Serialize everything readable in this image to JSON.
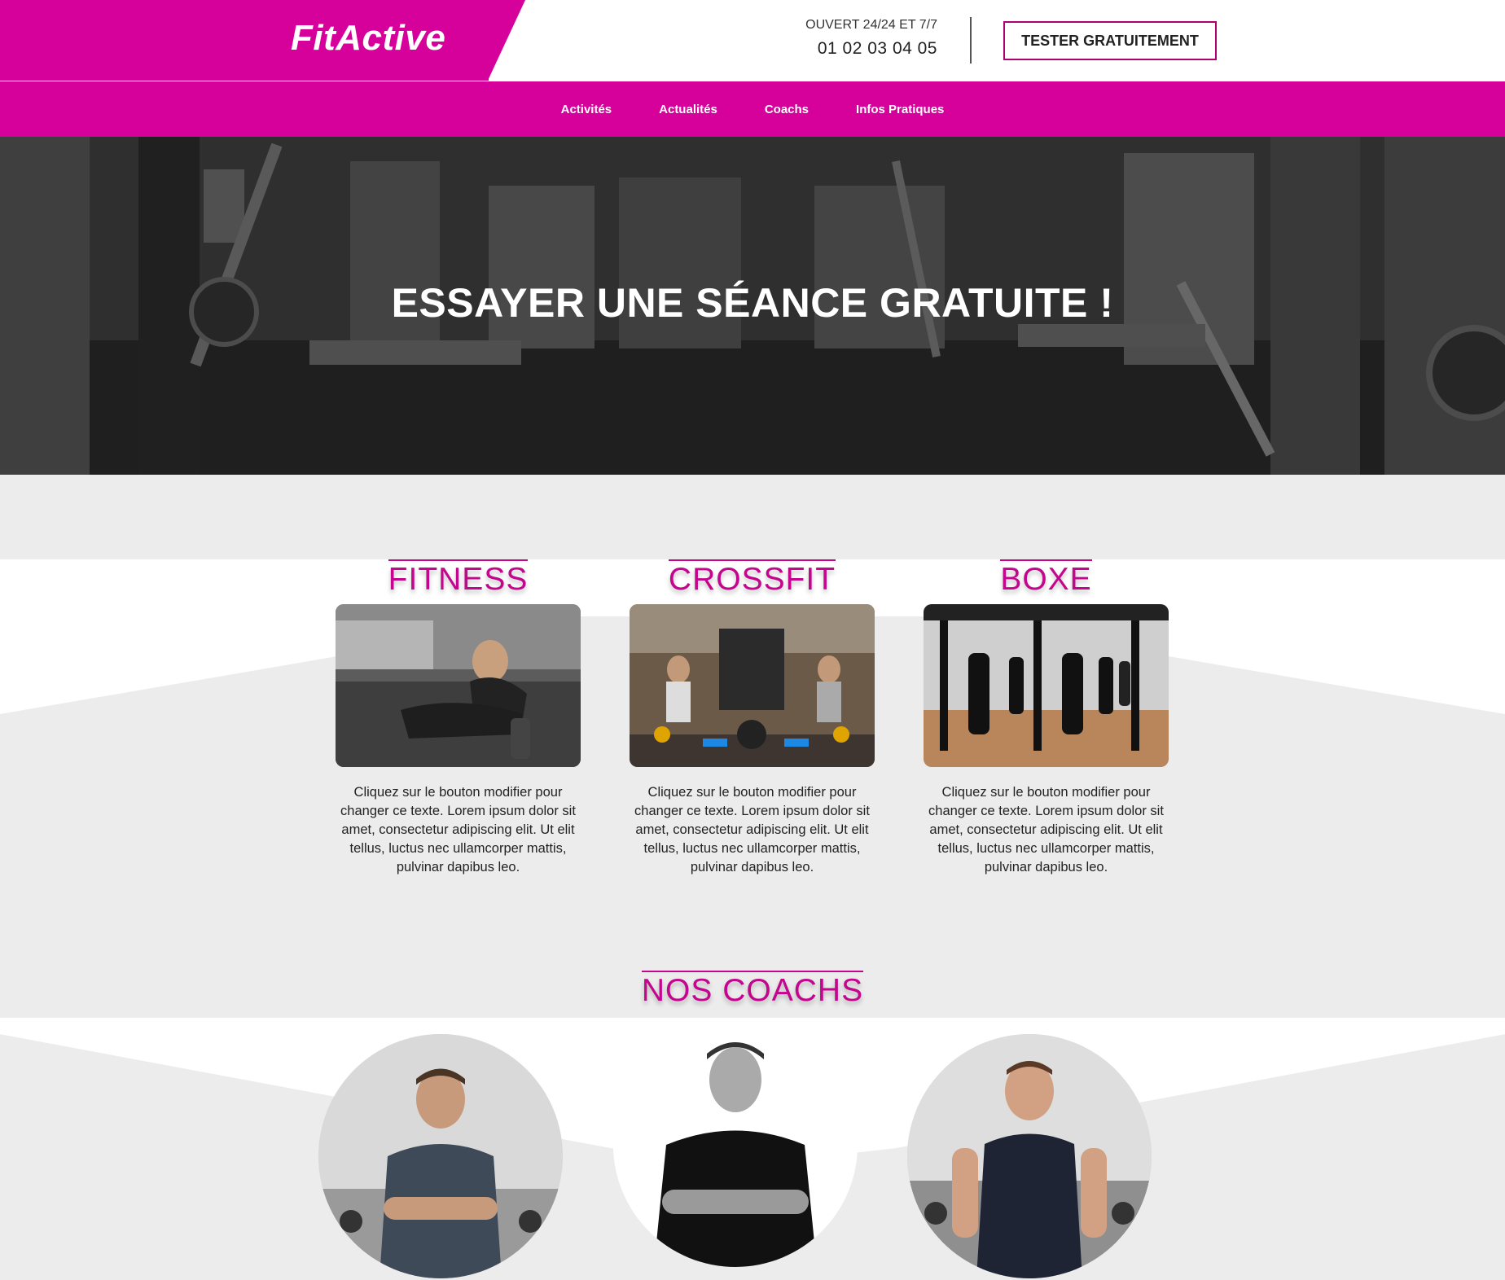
{
  "brand": {
    "logo": "FitActive",
    "accent": "#d6009b"
  },
  "header": {
    "hours": "OUVERT 24/24 ET 7/7",
    "phone": "01 02 03 04 05",
    "cta_label": "TESTER GRATUITEMENT"
  },
  "nav": {
    "items": [
      {
        "label": "Activités"
      },
      {
        "label": "Actualités"
      },
      {
        "label": "Coachs"
      },
      {
        "label": "Infos Pratiques"
      }
    ]
  },
  "hero": {
    "title": "ESSAYER UNE SÉANCE GRATUITE !"
  },
  "activities": [
    {
      "title": "FITNESS",
      "text": "Cliquez sur le bouton modifier pour changer ce texte. Lorem ipsum dolor sit amet, consectetur adipiscing elit. Ut elit tellus, luctus nec ullamcorper mattis, pulvinar dapibus leo."
    },
    {
      "title": "CROSSFIT",
      "text": "Cliquez sur le bouton modifier pour changer ce texte. Lorem ipsum dolor sit amet, consectetur adipiscing elit. Ut elit tellus, luctus nec ullamcorper mattis, pulvinar dapibus leo."
    },
    {
      "title": "BOXE",
      "text": "Cliquez sur le bouton modifier pour changer ce texte. Lorem ipsum dolor sit amet, consectetur adipiscing elit. Ut elit tellus, luctus nec ullamcorper mattis, pulvinar dapibus leo."
    }
  ],
  "coaches": {
    "title": "NOS COACHS"
  }
}
